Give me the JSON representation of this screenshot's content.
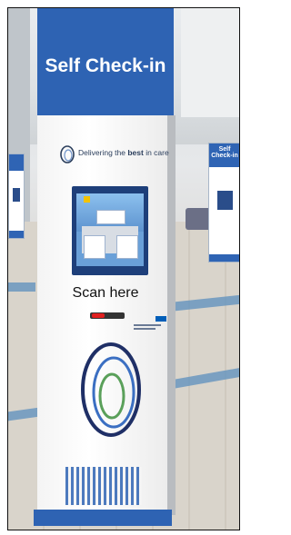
{
  "kiosk": {
    "title": "Self Check-in",
    "tagline_prefix": "Delivering the ",
    "tagline_bold": "best",
    "tagline_suffix": " in care",
    "scan_prompt": "Scan here",
    "colors": {
      "brand_blue": "#2e63b3",
      "scanner_light": "#e01e1e",
      "nhs_blue": "#005eb8"
    }
  },
  "background_kiosk": {
    "title": "Self Check-in"
  },
  "icons": [
    "trust-swirl-logo-icon",
    "nhs-logo-icon",
    "scanner-light-icon"
  ]
}
